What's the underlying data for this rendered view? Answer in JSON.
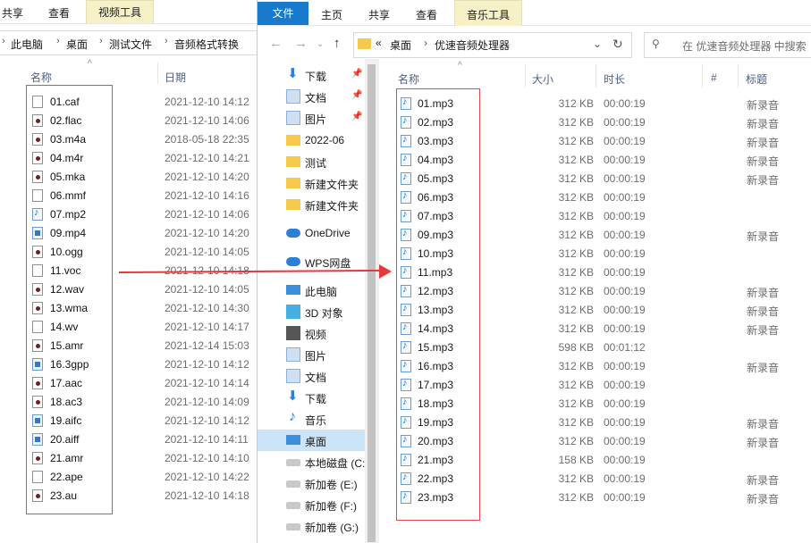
{
  "back_window": {
    "ribbon": {
      "share": "共享",
      "view": "查看",
      "context_tab": "视频工具"
    },
    "breadcrumb": [
      "此电脑",
      "桌面",
      "测试文件",
      "音频格式转换"
    ],
    "columns": {
      "name": "名称",
      "date": "日期"
    },
    "files": [
      {
        "name": "01.caf",
        "date": "2021-12-10 14:12",
        "icon": "file-blank-icon"
      },
      {
        "name": "02.flac",
        "date": "2021-12-10 14:06",
        "icon": "audio-file-icon"
      },
      {
        "name": "03.m4a",
        "date": "2018-05-18 22:35",
        "icon": "audio-file-icon"
      },
      {
        "name": "04.m4r",
        "date": "2021-12-10 14:21",
        "icon": "audio-file-icon"
      },
      {
        "name": "05.mka",
        "date": "2021-12-10 14:20",
        "icon": "audio-file-icon"
      },
      {
        "name": "06.mmf",
        "date": "2021-12-10 14:16",
        "icon": "file-blank-icon"
      },
      {
        "name": "07.mp2",
        "date": "2021-12-10 14:06",
        "icon": "music-file-icon"
      },
      {
        "name": "09.mp4",
        "date": "2021-12-10 14:20",
        "icon": "video-file-icon"
      },
      {
        "name": "10.ogg",
        "date": "2021-12-10 14:05",
        "icon": "audio-file-icon"
      },
      {
        "name": "11.voc",
        "date": "2021-12-10 14:18",
        "icon": "file-blank-icon"
      },
      {
        "name": "12.wav",
        "date": "2021-12-10 14:05",
        "icon": "audio-file-icon"
      },
      {
        "name": "13.wma",
        "date": "2021-12-10 14:30",
        "icon": "audio-file-icon"
      },
      {
        "name": "14.wv",
        "date": "2021-12-10 14:17",
        "icon": "file-blank-icon"
      },
      {
        "name": "15.amr",
        "date": "2021-12-14 15:03",
        "icon": "audio-file-icon"
      },
      {
        "name": "16.3gpp",
        "date": "2021-12-10 14:12",
        "icon": "video-file-icon"
      },
      {
        "name": "17.aac",
        "date": "2021-12-10 14:14",
        "icon": "audio-file-icon"
      },
      {
        "name": "18.ac3",
        "date": "2021-12-10 14:09",
        "icon": "audio-file-icon"
      },
      {
        "name": "19.aifc",
        "date": "2021-12-10 14:12",
        "icon": "video-file-icon"
      },
      {
        "name": "20.aiff",
        "date": "2021-12-10 14:11",
        "icon": "video-file-icon"
      },
      {
        "name": "21.amr",
        "date": "2021-12-10 14:10",
        "icon": "audio-file-icon"
      },
      {
        "name": "22.ape",
        "date": "2021-12-10 14:22",
        "icon": "file-blank-icon"
      },
      {
        "name": "23.au",
        "date": "2021-12-10 14:18",
        "icon": "audio-file-icon"
      }
    ]
  },
  "front_window": {
    "ribbon": {
      "file": "文件",
      "home": "主页",
      "share": "共享",
      "view": "查看",
      "context_tab": "音乐工具"
    },
    "address": {
      "overflow": "«",
      "crumb1": "桌面",
      "crumb2": "优速音频处理器"
    },
    "search_placeholder": "在 优速音频处理器 中搜索",
    "nav": [
      {
        "label": "下载",
        "icon": "download-arrow-icon",
        "pinned": true
      },
      {
        "label": "文档",
        "icon": "document-icon",
        "pinned": true
      },
      {
        "label": "图片",
        "icon": "pictures-icon",
        "pinned": true
      },
      {
        "label": "2022-06",
        "icon": "folder-icon",
        "pinned": false
      },
      {
        "label": "测试",
        "icon": "folder-icon",
        "pinned": false
      },
      {
        "label": "新建文件夹",
        "icon": "folder-icon",
        "pinned": false
      },
      {
        "label": "新建文件夹",
        "icon": "folder-icon",
        "pinned": false
      },
      {
        "label": "OneDrive",
        "icon": "cloud-icon",
        "pinned": false
      },
      {
        "label": "WPS网盘",
        "icon": "cloud-icon",
        "pinned": false
      },
      {
        "label": "此电脑",
        "icon": "computer-icon",
        "pinned": false
      },
      {
        "label": "3D 对象",
        "icon": "cube-icon",
        "pinned": false
      },
      {
        "label": "视频",
        "icon": "video-icon",
        "pinned": false
      },
      {
        "label": "图片",
        "icon": "pictures-icon",
        "pinned": false
      },
      {
        "label": "文档",
        "icon": "document-icon",
        "pinned": false
      },
      {
        "label": "下载",
        "icon": "download-arrow-icon",
        "pinned": false
      },
      {
        "label": "音乐",
        "icon": "music-note-icon",
        "pinned": false
      },
      {
        "label": "桌面",
        "icon": "desktop-icon",
        "pinned": false,
        "selected": true
      },
      {
        "label": "本地磁盘 (C:",
        "icon": "drive-icon",
        "pinned": false
      },
      {
        "label": "新加卷 (E:)",
        "icon": "drive-icon",
        "pinned": false
      },
      {
        "label": "新加卷 (F:)",
        "icon": "drive-icon",
        "pinned": false
      },
      {
        "label": "新加卷 (G:)",
        "icon": "drive-icon",
        "pinned": false
      }
    ],
    "columns": {
      "name": "名称",
      "size": "大小",
      "duration": "时长",
      "number": "#",
      "title": "标题"
    },
    "files": [
      {
        "name": "01.mp3",
        "size": "312 KB",
        "duration": "00:00:19",
        "title": "新录音"
      },
      {
        "name": "02.mp3",
        "size": "312 KB",
        "duration": "00:00:19",
        "title": "新录音"
      },
      {
        "name": "03.mp3",
        "size": "312 KB",
        "duration": "00:00:19",
        "title": "新录音"
      },
      {
        "name": "04.mp3",
        "size": "312 KB",
        "duration": "00:00:19",
        "title": "新录音"
      },
      {
        "name": "05.mp3",
        "size": "312 KB",
        "duration": "00:00:19",
        "title": "新录音"
      },
      {
        "name": "06.mp3",
        "size": "312 KB",
        "duration": "00:00:19",
        "title": ""
      },
      {
        "name": "07.mp3",
        "size": "312 KB",
        "duration": "00:00:19",
        "title": ""
      },
      {
        "name": "09.mp3",
        "size": "312 KB",
        "duration": "00:00:19",
        "title": "新录音"
      },
      {
        "name": "10.mp3",
        "size": "312 KB",
        "duration": "00:00:19",
        "title": ""
      },
      {
        "name": "11.mp3",
        "size": "312 KB",
        "duration": "00:00:19",
        "title": ""
      },
      {
        "name": "12.mp3",
        "size": "312 KB",
        "duration": "00:00:19",
        "title": "新录音"
      },
      {
        "name": "13.mp3",
        "size": "312 KB",
        "duration": "00:00:19",
        "title": "新录音"
      },
      {
        "name": "14.mp3",
        "size": "312 KB",
        "duration": "00:00:19",
        "title": "新录音"
      },
      {
        "name": "15.mp3",
        "size": "598 KB",
        "duration": "00:01:12",
        "title": ""
      },
      {
        "name": "16.mp3",
        "size": "312 KB",
        "duration": "00:00:19",
        "title": "新录音"
      },
      {
        "name": "17.mp3",
        "size": "312 KB",
        "duration": "00:00:19",
        "title": ""
      },
      {
        "name": "18.mp3",
        "size": "312 KB",
        "duration": "00:00:19",
        "title": ""
      },
      {
        "name": "19.mp3",
        "size": "312 KB",
        "duration": "00:00:19",
        "title": "新录音"
      },
      {
        "name": "20.mp3",
        "size": "312 KB",
        "duration": "00:00:19",
        "title": "新录音"
      },
      {
        "name": "21.mp3",
        "size": "158 KB",
        "duration": "00:00:19",
        "title": ""
      },
      {
        "name": "22.mp3",
        "size": "312 KB",
        "duration": "00:00:19",
        "title": "新录音"
      },
      {
        "name": "23.mp3",
        "size": "312 KB",
        "duration": "00:00:19",
        "title": "新录音"
      }
    ]
  },
  "colors": {
    "annotation_red": "#e14a4a",
    "file_tab_blue": "#1979ca",
    "context_tab_yellow": "#f6f1c6",
    "selected_nav": "#cce4f7"
  }
}
